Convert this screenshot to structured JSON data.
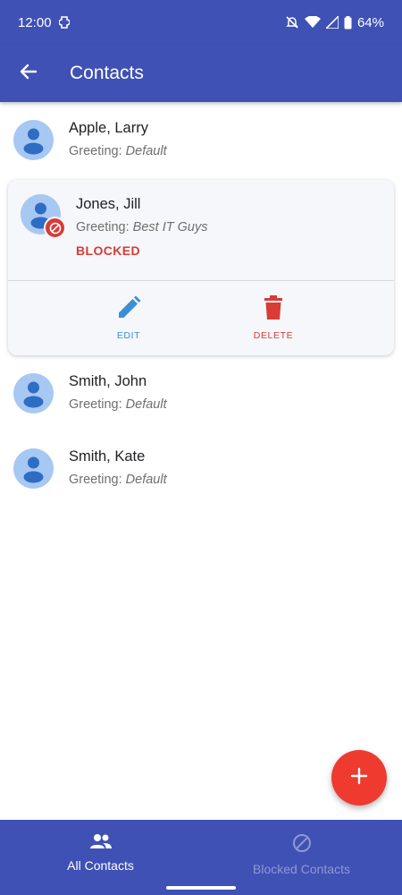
{
  "status_bar": {
    "time": "12:00",
    "battery": "64%"
  },
  "app_bar": {
    "title": "Contacts",
    "back_icon": "arrow-back-icon"
  },
  "greeting_prefix": "Greeting: ",
  "contacts": [
    {
      "name": "Apple, Larry",
      "greeting": "Default"
    },
    {
      "name": "Jones, Jill",
      "greeting": "Best IT Guys",
      "status": "BLOCKED"
    },
    {
      "name": "Smith, John",
      "greeting": "Default"
    },
    {
      "name": "Smith, Kate",
      "greeting": "Default"
    }
  ],
  "card_actions": {
    "edit_label": "EDIT",
    "delete_label": "DELETE"
  },
  "bottom_nav": {
    "items": [
      {
        "label": "All Contacts",
        "icon": "people-icon",
        "active": true
      },
      {
        "label": "Blocked Contacts",
        "icon": "block-icon",
        "active": false
      }
    ]
  },
  "colors": {
    "primary": "#3f51b5",
    "accent_fab": "#ee3a2f",
    "blocked_red": "#d93b35",
    "edit_blue": "#3d8fd4",
    "avatar_bg": "#a7c8f2",
    "avatar_fg": "#2f6cc4"
  }
}
